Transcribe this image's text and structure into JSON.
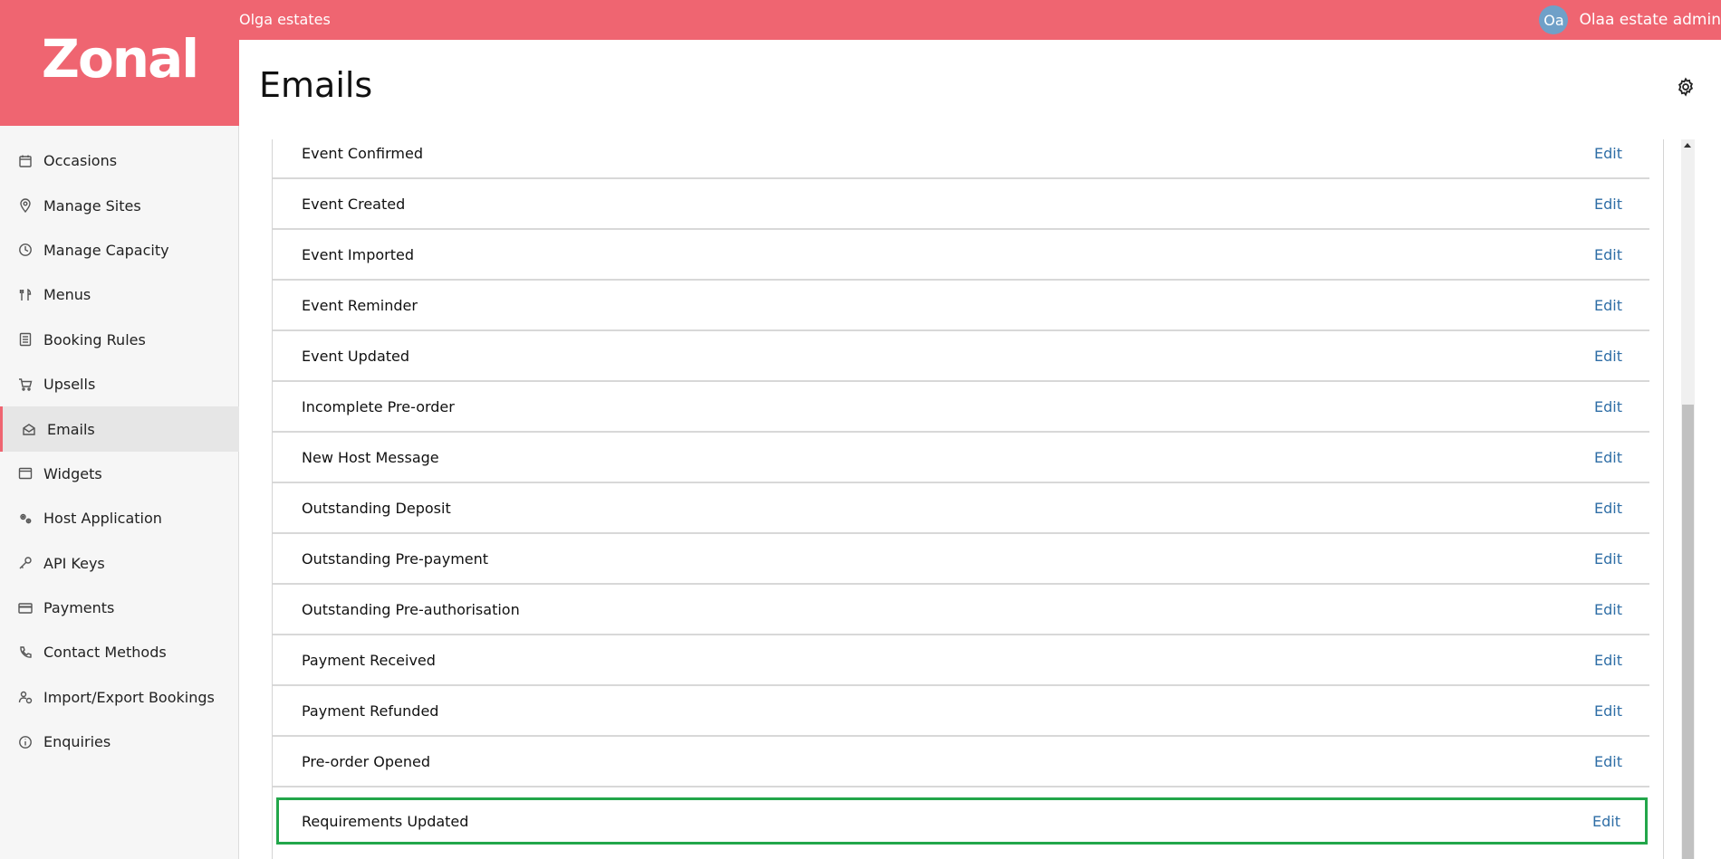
{
  "topbar": {
    "org_name": "Olga estates",
    "avatar_initials": "Oa",
    "user_name": "Olaa estate admin"
  },
  "logo": {
    "text": "Zonal"
  },
  "sidebar": {
    "items": [
      {
        "label": "Occasions",
        "icon": "calendar-icon"
      },
      {
        "label": "Manage Sites",
        "icon": "map-pin-icon"
      },
      {
        "label": "Manage Capacity",
        "icon": "clock-icon"
      },
      {
        "label": "Menus",
        "icon": "cutlery-icon"
      },
      {
        "label": "Booking Rules",
        "icon": "rules-list-icon"
      },
      {
        "label": "Upsells",
        "icon": "cart-icon"
      },
      {
        "label": "Emails",
        "icon": "email-icon",
        "active": true
      },
      {
        "label": "Widgets",
        "icon": "widget-window-icon"
      },
      {
        "label": "Host Application",
        "icon": "gears-icon"
      },
      {
        "label": "API Keys",
        "icon": "key-icon"
      },
      {
        "label": "Payments",
        "icon": "credit-card-icon"
      },
      {
        "label": "Contact Methods",
        "icon": "phone-icon"
      },
      {
        "label": "Import/Export Bookings",
        "icon": "user-transfer-icon"
      },
      {
        "label": "Enquiries",
        "icon": "info-icon"
      }
    ]
  },
  "main": {
    "title": "Emails",
    "settings_icon": "gear-icon",
    "edit_label": "Edit",
    "emails": [
      "Event Confirmed",
      "Event Created",
      "Event Imported",
      "Event Reminder",
      "Event Updated",
      "Incomplete Pre-order",
      "New Host Message",
      "Outstanding Deposit",
      "Outstanding Pre-payment",
      "Outstanding Pre-authorisation",
      "Payment Received",
      "Payment Refunded",
      "Pre-order Opened",
      "Requirements Updated"
    ],
    "highlighted_email": "Requirements Updated"
  },
  "colors": {
    "brand": "#ef6571",
    "link": "#2f6ea6",
    "highlight": "#22a64a"
  }
}
